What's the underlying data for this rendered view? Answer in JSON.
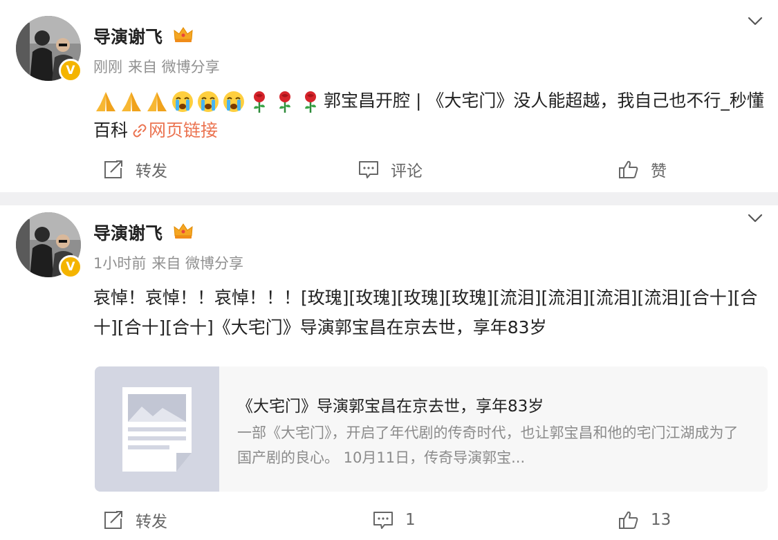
{
  "posts": [
    {
      "author": "导演谢飞",
      "time": "刚刚",
      "source": "来自 微博分享",
      "text": "郭宝昌开腔 | 《大宅门》没人能超越，我自己也不行_秒懂百科",
      "link_label": "网页链接",
      "emojis": [
        "pray-emoji",
        "pray-emoji",
        "pray-emoji",
        "crying-emoji",
        "crying-emoji",
        "crying-emoji",
        "rose-emoji",
        "rose-emoji",
        "rose-emoji"
      ],
      "actions": {
        "repost": "转发",
        "comment": "评论",
        "like": "赞"
      }
    },
    {
      "author": "导演谢飞",
      "time": "1小时前",
      "source": "来自 微博分享",
      "text": "哀悼！哀悼！！哀悼！！！[玫瑰][玫瑰][玫瑰][玫瑰][流泪][流泪][流泪][流泪][合十][合十][合十][合十]《大宅门》导演郭宝昌在京去世，享年83岁",
      "card": {
        "title": "《大宅门》导演郭宝昌在京去世，享年83岁",
        "description": "一部《大宅门》，开启了年代剧的传奇时代，也让郭宝昌和他的宅门江湖成为了国产剧的良心。 10月11日，传奇导演郭宝..."
      },
      "actions": {
        "repost": "转发",
        "comment": "1",
        "like": "13"
      }
    }
  ],
  "colors": {
    "link": "#eb7350",
    "badge": "#f4b400",
    "separator": "#f0f0f2",
    "meta": "#909090"
  }
}
